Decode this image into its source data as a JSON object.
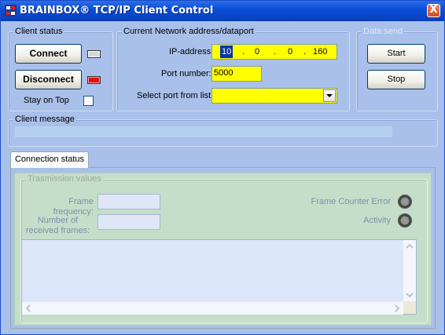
{
  "window": {
    "title": "BRAINBOX® TCP/IP Client Control",
    "close_glyph": "X"
  },
  "client_status": {
    "legend": "Client status",
    "connect_label": "Connect",
    "disconnect_label": "Disconnect",
    "connect_led_color": "#d8d8d8",
    "disconnect_led_color": "#e01010",
    "stay_on_top_label": "Stay on Top",
    "stay_on_top_checked": false
  },
  "network": {
    "legend": "Current Network address/dataport",
    "ip_label": "IP-address:",
    "ip_octets": [
      "10",
      "0",
      "0",
      "160"
    ],
    "ip_dot": ".",
    "port_label": "Port number:",
    "port_value": "5000",
    "select_label": "Select port from list:",
    "select_value": ""
  },
  "data_send": {
    "legend": "Data send",
    "start_label": "Start",
    "stop_label": "Stop"
  },
  "client_message": {
    "legend": "Client message",
    "value": ""
  },
  "tabs": [
    {
      "label": "Connection status",
      "active": true
    }
  ],
  "connection_status": {
    "group_legend": "Trasmission values",
    "frame_frequency_label": "Frame frequency:",
    "frame_frequency_value": "",
    "received_frames_label": "Number of received frames:",
    "received_frames_value": "",
    "frame_counter_error_label": "Frame Counter Error",
    "activity_label": "Activity",
    "log_text": ""
  },
  "colors": {
    "field_yellow": "#ffff00",
    "panel_green": "#c5dec9",
    "window_blue": "#a9c0ea"
  }
}
